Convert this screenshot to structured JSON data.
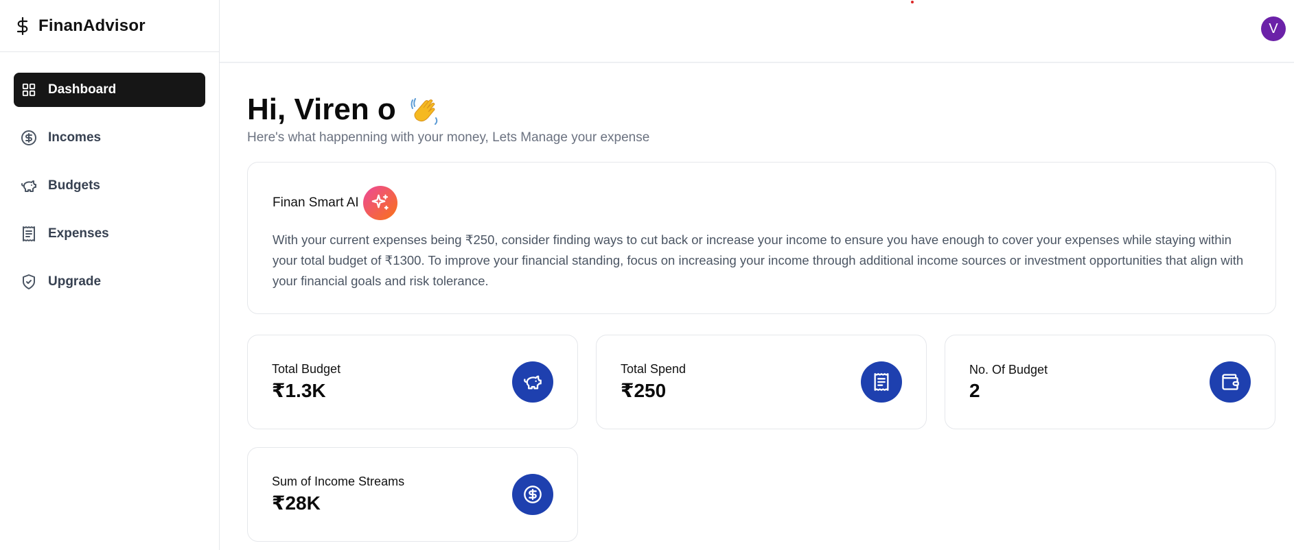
{
  "brand": {
    "name": "FinanAdvisor",
    "icon": "dollar-icon"
  },
  "sidebar": {
    "items": [
      {
        "label": "Dashboard",
        "icon": "layout-grid-icon",
        "active": true
      },
      {
        "label": "Incomes",
        "icon": "circle-dollar-icon",
        "active": false
      },
      {
        "label": "Budgets",
        "icon": "piggy-bank-icon",
        "active": false
      },
      {
        "label": "Expenses",
        "icon": "receipt-icon",
        "active": false
      },
      {
        "label": "Upgrade",
        "icon": "shield-check-icon",
        "active": false
      }
    ]
  },
  "header": {
    "avatar_initial": "V",
    "avatar_color": "#6b21a8"
  },
  "main": {
    "greeting": "Hi, Viren o",
    "greeting_emoji": "waving-hand-icon",
    "subtitle": "Here's what happenning with your money, Lets Manage your expense"
  },
  "ai": {
    "title": "Finan Smart AI",
    "icon": "sparkles-icon",
    "text": "With your current expenses being ₹250, consider finding ways to cut back or increase your income to ensure you have enough to cover your expenses while staying within your total budget of ₹1300. To improve your financial standing, focus on increasing your income through additional income sources or investment opportunities that align with your financial goals and risk tolerance."
  },
  "stats": [
    {
      "label": "Total Budget",
      "value": "₹1.3K",
      "icon": "piggy-bank-icon"
    },
    {
      "label": "Total Spend",
      "value": "₹250",
      "icon": "receipt-icon"
    },
    {
      "label": "No. Of Budget",
      "value": "2",
      "icon": "wallet-icon"
    },
    {
      "label": "Sum of Income Streams",
      "value": "₹28K",
      "icon": "circle-dollar-icon"
    }
  ],
  "colors": {
    "accent": "#1e40af",
    "active_nav": "#161616",
    "ai_gradient": [
      "#ec4899",
      "#f97316"
    ]
  }
}
